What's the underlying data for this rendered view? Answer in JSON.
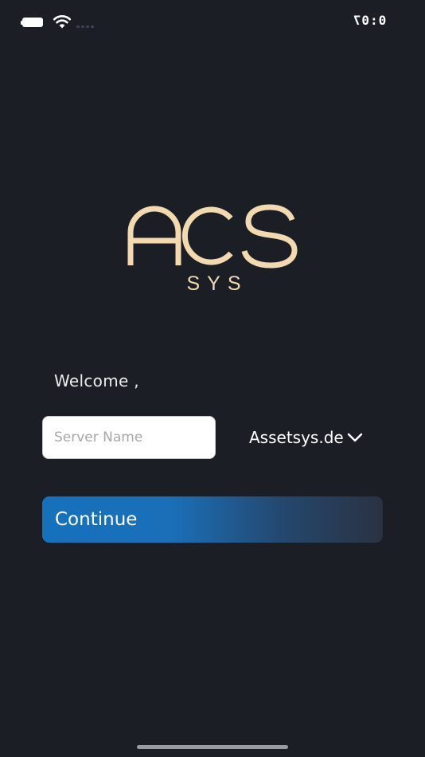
{
  "status_bar": {
    "time": "0:07",
    "battery_icon": "battery-icon",
    "wifi_icon": "wifi-icon",
    "signal_icon": "cellular-signal-icon"
  },
  "logo": {
    "brand": "ACS",
    "sub": "SYS",
    "color": "#f2d9ae"
  },
  "welcome": {
    "text": "Welcome ,"
  },
  "server": {
    "value": "",
    "placeholder": "Server Name"
  },
  "domain": {
    "selected": "Assetsys.de",
    "icon": "chevron-down-icon"
  },
  "continue": {
    "label": "Continue"
  },
  "colors": {
    "background": "#1c1e26",
    "button_start": "#1671bd",
    "button_end": "#2a3242"
  }
}
